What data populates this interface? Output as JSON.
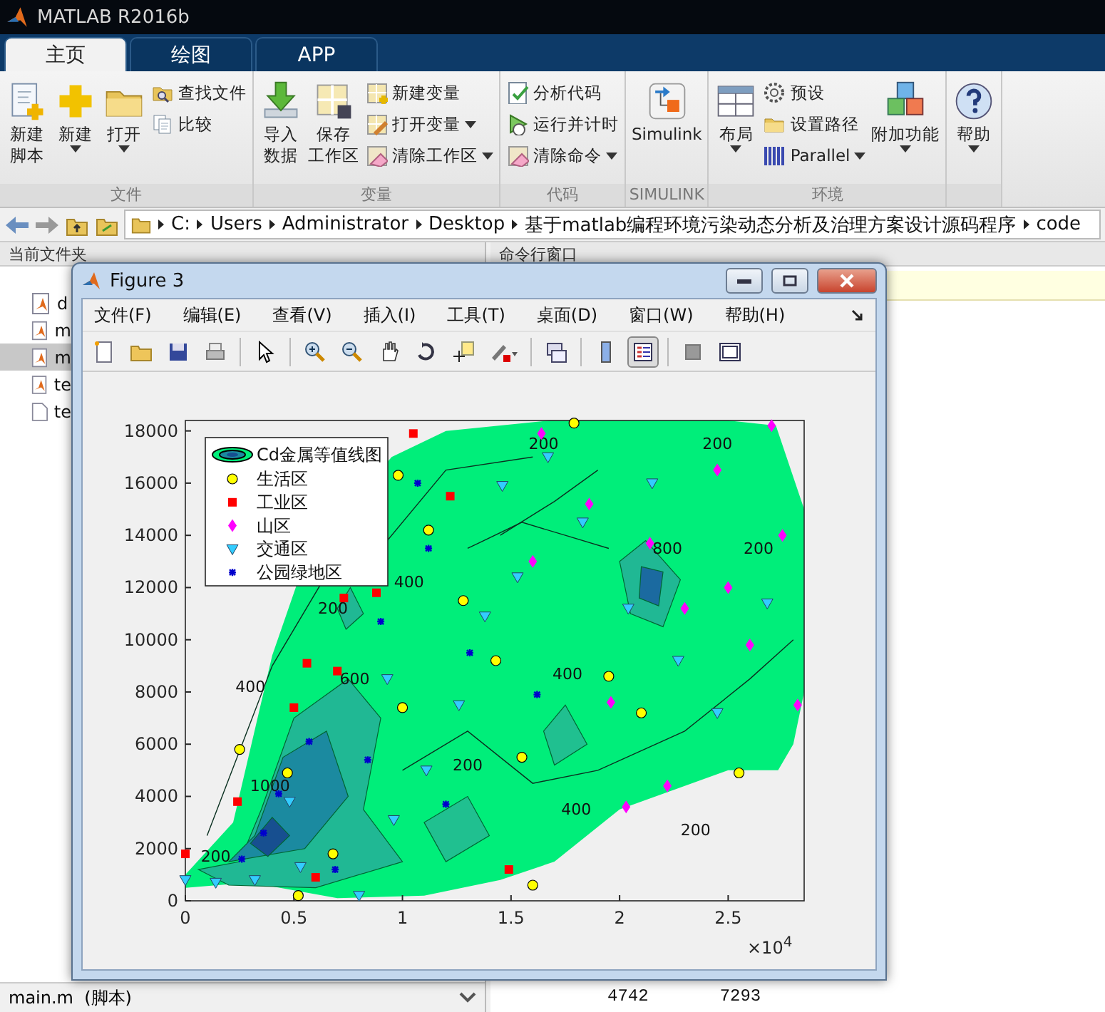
{
  "app": {
    "title": "MATLAB R2016b"
  },
  "tabs": [
    {
      "label": "主页",
      "selected": true
    },
    {
      "label": "绘图",
      "selected": false
    },
    {
      "label": "APP",
      "selected": false
    }
  ],
  "toolstrip": [
    {
      "title": "文件",
      "columns": [
        {
          "kind": "large",
          "lines": [
            "新建",
            "脚本"
          ],
          "dropdown": false
        },
        {
          "kind": "large",
          "lines": [
            "新建"
          ],
          "dropdown": true
        },
        {
          "kind": "large",
          "lines": [
            "打开"
          ],
          "dropdown": true
        },
        {
          "kind": "stack",
          "items": [
            {
              "label": "查找文件",
              "dropdown": false
            },
            {
              "label": "比较",
              "dropdown": false
            }
          ]
        }
      ]
    },
    {
      "title": "变量",
      "columns": [
        {
          "kind": "large",
          "lines": [
            "导入",
            "数据"
          ],
          "dropdown": false
        },
        {
          "kind": "large",
          "lines": [
            "保存",
            "工作区"
          ],
          "dropdown": false
        },
        {
          "kind": "stack",
          "items": [
            {
              "label": "新建变量",
              "dropdown": false
            },
            {
              "label": "打开变量",
              "dropdown": true
            },
            {
              "label": "清除工作区",
              "dropdown": true
            }
          ]
        }
      ]
    },
    {
      "title": "代码",
      "columns": [
        {
          "kind": "stack",
          "items": [
            {
              "label": "分析代码",
              "dropdown": false
            },
            {
              "label": "运行并计时",
              "dropdown": false
            },
            {
              "label": "清除命令",
              "dropdown": true
            }
          ]
        }
      ]
    },
    {
      "title": "SIMULINK",
      "columns": [
        {
          "kind": "large",
          "lines": [
            "Simulink"
          ],
          "dropdown": false
        }
      ]
    },
    {
      "title": "环境",
      "columns": [
        {
          "kind": "large",
          "lines": [
            "布局"
          ],
          "dropdown": true
        },
        {
          "kind": "stack",
          "items": [
            {
              "label": "预设",
              "dropdown": false
            },
            {
              "label": "设置路径",
              "dropdown": false
            },
            {
              "label": "Parallel",
              "dropdown": true
            }
          ]
        },
        {
          "kind": "large",
          "lines": [
            "附加功能"
          ],
          "dropdown": true
        }
      ]
    },
    {
      "columns": [
        {
          "kind": "large",
          "lines": [
            "帮助"
          ],
          "dropdown": true
        }
      ]
    }
  ],
  "path": [
    "C:",
    "Users",
    "Administrator",
    "Desktop",
    "基于matlab编程环境污染动态分析及治理方案设计源码程序",
    "code"
  ],
  "current_folder": {
    "title": "当前文件夹",
    "files": [
      {
        "name": "d",
        "kind": "mfile",
        "selected": false
      },
      {
        "name": "m",
        "kind": "mfile",
        "selected": false
      },
      {
        "name": "m",
        "kind": "mfile",
        "selected": true
      },
      {
        "name": "te",
        "kind": "mfile",
        "selected": false
      },
      {
        "name": "te",
        "kind": "plain",
        "selected": false
      }
    ],
    "details": "main.m  (脚本)"
  },
  "command_window": {
    "title": "命令行窗口",
    "output": [
      "4742",
      "7293"
    ]
  },
  "figure": {
    "title": "Figure 3",
    "menu": [
      "文件(F)",
      "编辑(E)",
      "查看(V)",
      "插入(I)",
      "工具(T)",
      "桌面(D)",
      "窗口(W)",
      "帮助(H)"
    ],
    "legend_button": {
      "pressed": true
    },
    "contour_legend": "Cd金属等值线图",
    "x_exponent": "×10$^{4}$",
    "chart_data": {
      "type": "scatter",
      "legend": "upper left",
      "xlim": [
        0,
        2.85
      ],
      "ylim": [
        0,
        18400
      ],
      "xticks": [
        0,
        0.5,
        1,
        1.5,
        2,
        2.5
      ],
      "yticks": [
        0,
        2000,
        4000,
        6000,
        8000,
        10000,
        12000,
        14000,
        16000,
        18000
      ],
      "series": [
        {
          "name": "生活区",
          "color": "#ffff00",
          "x": [
            0.25,
            0.47,
            0.52,
            0.68,
            0.98,
            1.12,
            1.28,
            1.43,
            1.55,
            1.79,
            1.95,
            2.1,
            1.6,
            2.55,
            1.0
          ],
          "values": [
            5800,
            4900,
            200,
            1800,
            16300,
            14200,
            11500,
            9200,
            5500,
            18300,
            8600,
            7200,
            600,
            4900,
            7400
          ]
        },
        {
          "name": "工业区",
          "color": "#ff0000",
          "x": [
            0,
            0.24,
            0.5,
            0.56,
            0.73,
            0.88,
            1.05,
            1.22,
            0.7,
            1.49,
            0.6
          ],
          "values": [
            1800,
            3800,
            7400,
            9100,
            11600,
            11800,
            17900,
            15500,
            8800,
            1200,
            900
          ]
        },
        {
          "name": "山区",
          "color": "#ff00ff",
          "x": [
            1.64,
            1.86,
            2.14,
            2.3,
            2.45,
            2.6,
            2.75,
            2.82,
            2.22,
            1.96,
            2.7,
            2.5,
            1.6,
            2.03
          ],
          "values": [
            17900,
            15200,
            13700,
            11200,
            16500,
            9800,
            14000,
            7500,
            4400,
            7600,
            18200,
            12000,
            13000,
            3600
          ]
        },
        {
          "name": "交通区",
          "color": "#33ccff",
          "x": [
            0,
            0.14,
            0.32,
            0.53,
            0.8,
            0.96,
            1.11,
            1.26,
            1.38,
            1.53,
            1.67,
            1.83,
            2.04,
            2.27,
            2.45,
            1.46,
            0.93,
            0.48,
            2.15,
            2.68
          ],
          "values": [
            800,
            700,
            800,
            1300,
            200,
            3100,
            5000,
            7500,
            10900,
            12400,
            17000,
            14500,
            11200,
            9200,
            7200,
            15900,
            8500,
            3800,
            16000,
            11400
          ]
        },
        {
          "name": "公园绿地区",
          "color": "#0000cc",
          "x": [
            0.26,
            0.36,
            0.43,
            0.57,
            0.9,
            1.07,
            1.12,
            1.31,
            1.62,
            1.2,
            0.84,
            0.69
          ],
          "values": [
            1600,
            2600,
            4100,
            6100,
            10700,
            16000,
            13500,
            9500,
            7900,
            3700,
            5400,
            1200
          ]
        }
      ],
      "annotations": [
        "200",
        "200",
        "200",
        "200",
        "200",
        "200",
        "400",
        "400",
        "400",
        "600",
        "800",
        "1000",
        "200",
        "400"
      ]
    }
  }
}
